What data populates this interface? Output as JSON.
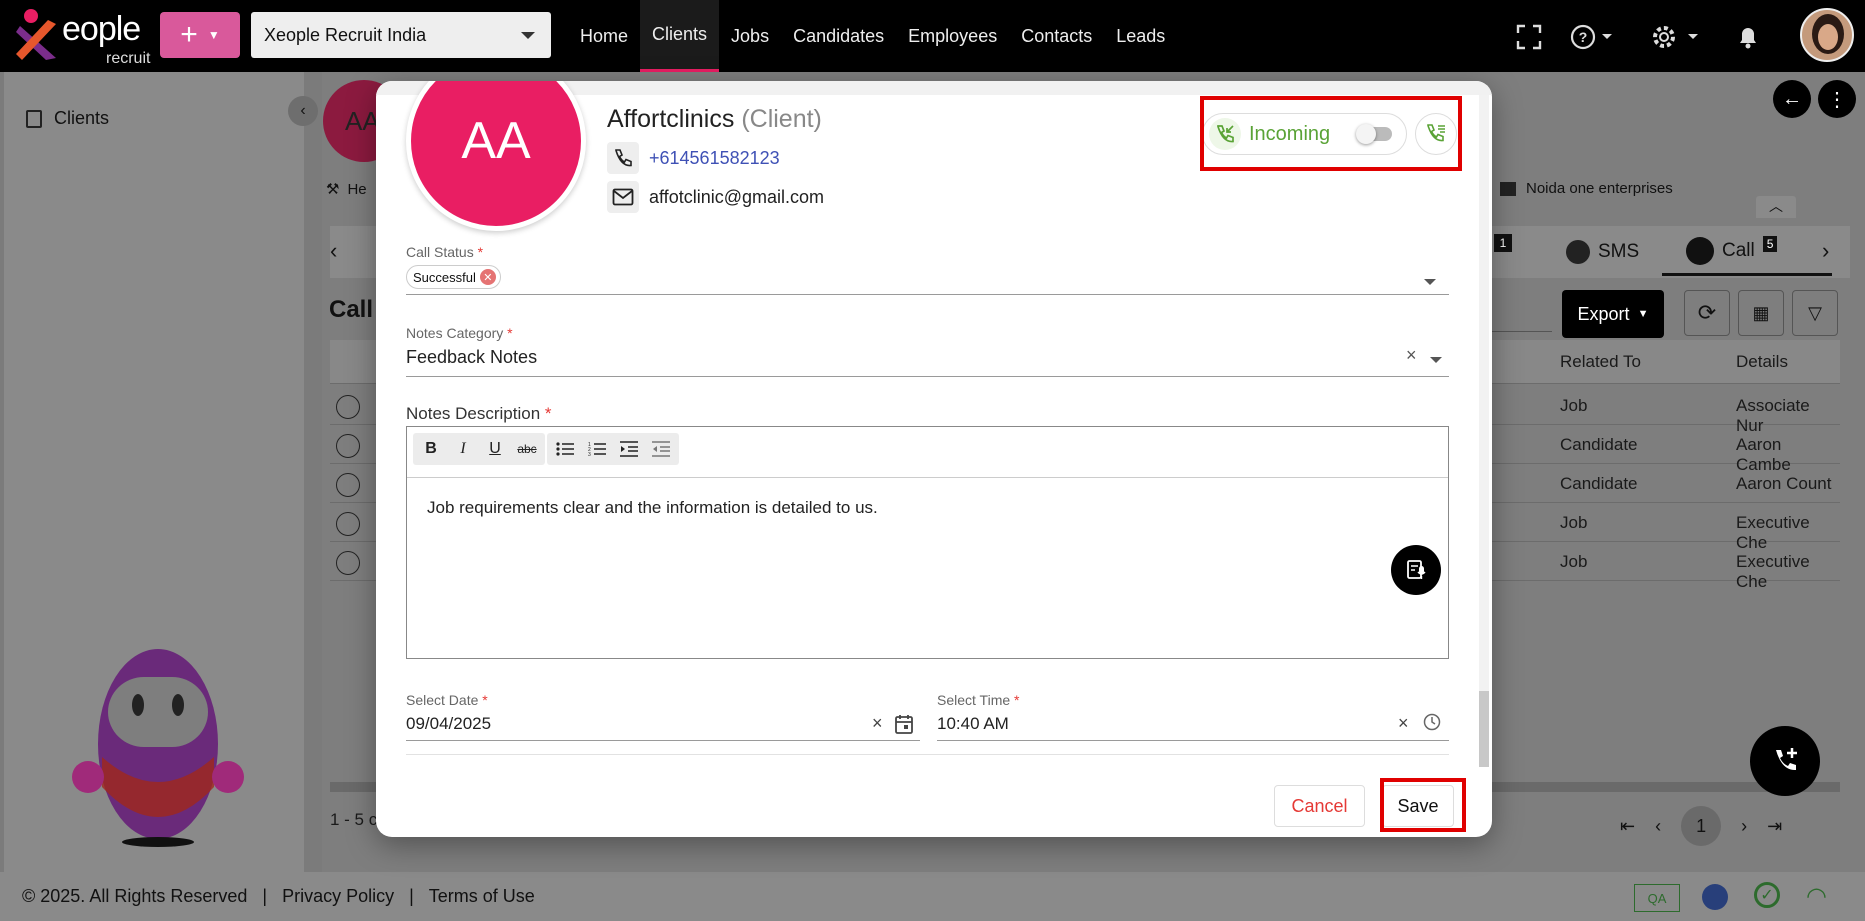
{
  "header": {
    "logo_text": "eople",
    "logo_sub": "recruit",
    "company": "Xeople Recruit India",
    "nav": [
      "Home",
      "Clients",
      "Jobs",
      "Candidates",
      "Employees",
      "Contacts",
      "Leads"
    ],
    "active_nav": "Clients"
  },
  "background": {
    "sidebar_label": "Clients",
    "section_title": "Call",
    "enterprise": "Noida one enterprises",
    "tabs": [
      {
        "label": "SMS"
      },
      {
        "label": "Call",
        "badge": "5"
      }
    ],
    "other_badge": "1",
    "export_label": "Export",
    "columns": [
      "Related To",
      "Details"
    ],
    "rows": [
      {
        "related": "Job",
        "details": "Associate Nur"
      },
      {
        "related": "Candidate",
        "details": "Aaron Cambe"
      },
      {
        "related": "Candidate",
        "details": "Aaron Count"
      },
      {
        "related": "Job",
        "details": "Executive Che"
      },
      {
        "related": "Job",
        "details": "Executive Che"
      }
    ],
    "pagination_info": "1 - 5 c",
    "current_page": "1",
    "partial_avatar": "AA",
    "partial_text": "He"
  },
  "footer": {
    "copyright": "© 2025. All Rights Reserved",
    "privacy": "Privacy Policy",
    "terms": "Terms of Use",
    "env_badge": "QA"
  },
  "modal": {
    "avatar_initials": "AA",
    "client_name": "Affortclinics",
    "client_type": "(Client)",
    "phone": "+614561582123",
    "email": "affotclinic@gmail.com",
    "call_direction": "Incoming",
    "call_status_label": "Call Status",
    "call_status_value": "Successful",
    "notes_category_label": "Notes Category",
    "notes_category_value": "Feedback Notes",
    "notes_description_label": "Notes Description",
    "notes_description": "Job requirements clear and the information is detailed to us.",
    "select_date_label": "Select Date",
    "select_date_value": "09/04/2025",
    "select_time_label": "Select Time",
    "select_time_value": "10:40 AM",
    "cancel_label": "Cancel",
    "save_label": "Save",
    "required_mark": "*"
  },
  "colors": {
    "accent": "#e91e63",
    "incoming_green": "#5aa336",
    "highlight": "#e00000",
    "cancel_red": "#e53935"
  }
}
